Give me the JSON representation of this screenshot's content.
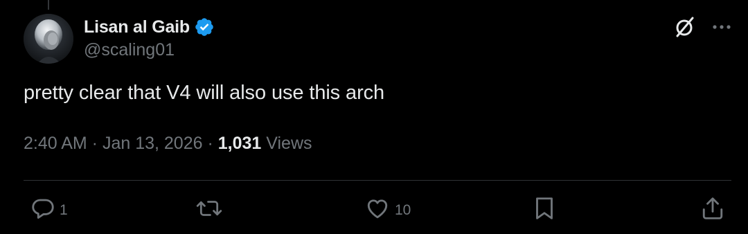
{
  "author": {
    "display_name": "Lisan al Gaib",
    "handle": "@scaling01",
    "verified_icon": "verified-badge-icon",
    "verified_color": "#1d9bf0"
  },
  "top_actions": {
    "grok_icon": "grok-icon",
    "more_icon": "more-horizontal-icon"
  },
  "tweet": {
    "text": "pretty clear that V4 will also use this arch"
  },
  "meta": {
    "time": "2:40 AM",
    "separator1": " · ",
    "date": "Jan 13, 2026",
    "separator2": " · ",
    "views_count": "1,031",
    "views_label": " Views"
  },
  "actions": {
    "reply": {
      "icon": "reply-icon",
      "count": "1"
    },
    "repost": {
      "icon": "repost-icon",
      "count": ""
    },
    "like": {
      "icon": "heart-icon",
      "count": "10"
    },
    "bookmark": {
      "icon": "bookmark-icon"
    },
    "share": {
      "icon": "share-icon"
    }
  },
  "colors": {
    "background": "#000000",
    "primary_text": "#e7e9ea",
    "secondary_text": "#71767b",
    "divider": "#2f3336",
    "accent": "#1d9bf0"
  }
}
